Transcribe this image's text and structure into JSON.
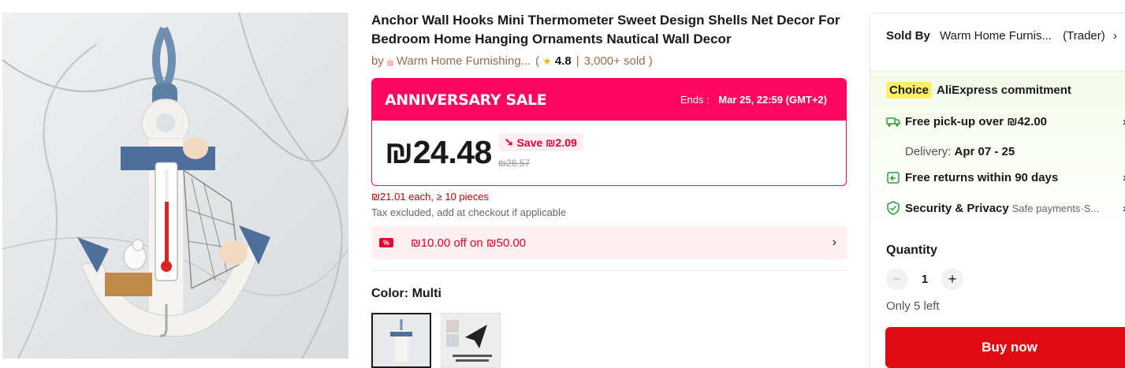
{
  "product": {
    "title": "Anchor Wall Hooks Mini Thermometer Sweet Design Shells Net Decor For Bedroom Home Hanging Ornaments Nautical Wall Decor",
    "by": "by",
    "store_name": "Warm Home Furnishing...",
    "rating": "4.8",
    "sold": "3,000+ sold )",
    "open_paren": "("
  },
  "sale": {
    "title": "ANNIVERSARY SALE",
    "ends_label": "Ends :",
    "ends_value": "Mar 25, 22:59 (GMT+2)",
    "price": "₪24.48",
    "save": "Save ₪2.09",
    "original_price": "₪26.57",
    "bulk": "₪21.01 each, ≥ 10 pieces",
    "tax": "Tax excluded, add at checkout if applicable"
  },
  "coupon": {
    "text": "₪10.00 off on ₪50.00",
    "icon_text": "%"
  },
  "color": {
    "label": "Color:",
    "value": "Multi"
  },
  "panel": {
    "sold_by_label": "Sold By",
    "store": "Warm Home Furnis...",
    "trader": "(Trader)",
    "choice_badge": "Choice",
    "commitment": "AliExpress commitment",
    "pickup": "Free pick-up over ₪42.00",
    "delivery_label": "Delivery:",
    "delivery_dates": "Apr 07 - 25",
    "returns": "Free returns within 90 days",
    "security": "Security & Privacy",
    "security_sub": "Safe payments·S...",
    "quantity_label": "Quantity",
    "quantity": "1",
    "stock": "Only 5 left",
    "buy_now": "Buy now"
  },
  "colors": {
    "accent": "#fd0660",
    "buy": "#de0b12",
    "choice": "#fdef67"
  }
}
